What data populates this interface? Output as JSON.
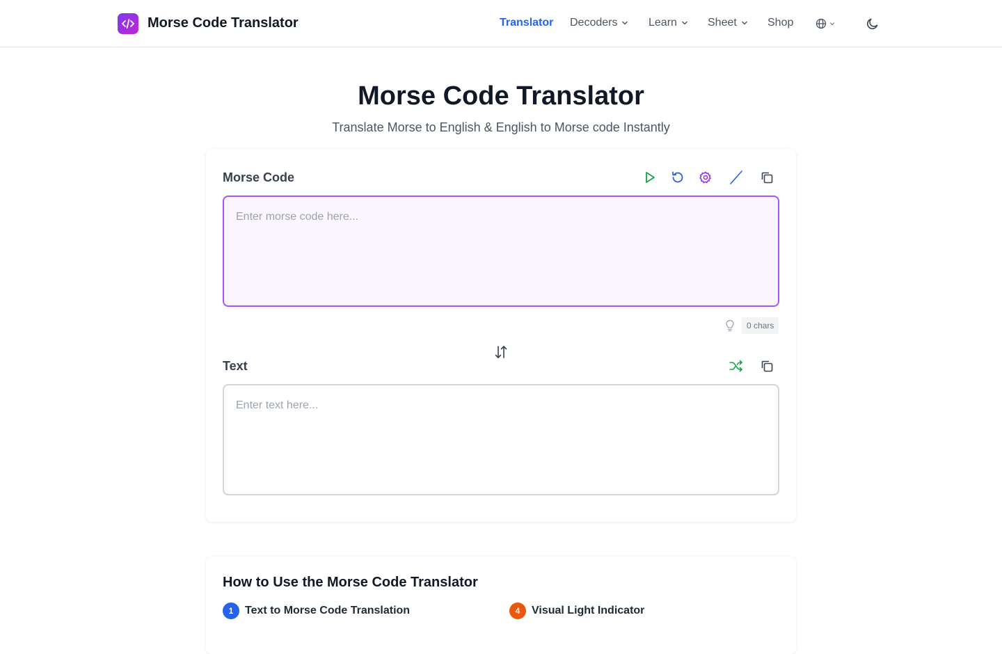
{
  "header": {
    "brand": "Morse Code Translator",
    "nav": [
      {
        "label": "Translator",
        "active": true,
        "dropdown": false
      },
      {
        "label": "Decoders",
        "active": false,
        "dropdown": true
      },
      {
        "label": "Learn",
        "active": false,
        "dropdown": true
      },
      {
        "label": "Sheet",
        "active": false,
        "dropdown": true
      },
      {
        "label": "Shop",
        "active": false,
        "dropdown": false
      }
    ],
    "accent_color": "#2563eb",
    "logo_gradient": [
      "#7c3aed",
      "#c026d3"
    ],
    "icons": [
      "code-icon",
      "globe-icon",
      "chevron-down-icon",
      "moon-icon"
    ]
  },
  "hero": {
    "title": "Morse Code Translator",
    "subtitle": "Translate Morse to English & English to Morse code Instantly"
  },
  "translator": {
    "morse": {
      "label": "Morse Code",
      "placeholder": "Enter morse code here...",
      "value": "",
      "border_color": "#a855f7",
      "toolbar": [
        "play-icon",
        "replay-icon",
        "settings-icon",
        "slash-icon",
        "copy-icon"
      ]
    },
    "char_count": "0 chars",
    "text": {
      "label": "Text",
      "placeholder": "Enter text here...",
      "value": "",
      "toolbar": [
        "shuffle-icon",
        "copy-icon"
      ]
    }
  },
  "howto": {
    "title": "How to Use the Morse Code Translator",
    "steps": [
      {
        "number": "1",
        "label": "Text to Morse Code Translation",
        "color": "#2563eb"
      },
      {
        "number": "4",
        "label": "Visual Light Indicator",
        "color": "#ea580c"
      }
    ]
  }
}
